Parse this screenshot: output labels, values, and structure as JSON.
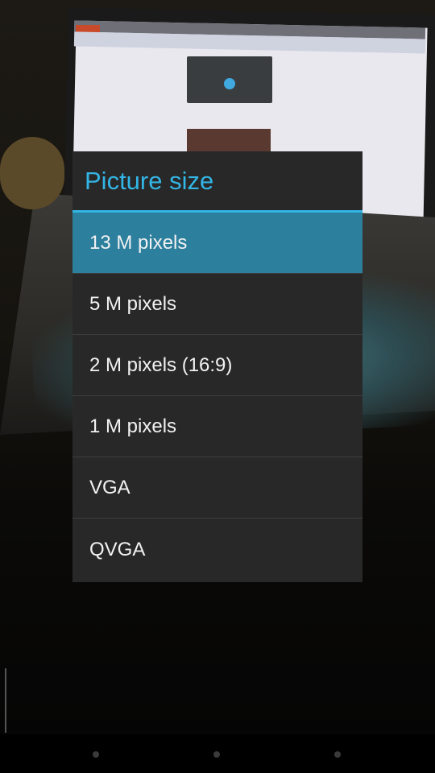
{
  "dialog": {
    "title": "Picture size",
    "selected_index": 0,
    "options": [
      {
        "label": "13 M pixels"
      },
      {
        "label": "5 M pixels"
      },
      {
        "label": "2 M pixels (16:9)"
      },
      {
        "label": "1 M pixels"
      },
      {
        "label": "VGA"
      },
      {
        "label": "QVGA"
      }
    ]
  },
  "colors": {
    "accent": "#33b5e5",
    "selected_background": "#2c7f9d",
    "dialog_background": "#282828",
    "option_text": "#f2f2f2"
  },
  "navbar": {
    "buttons": [
      "back-dot-icon",
      "home-dot-icon",
      "recents-dot-icon"
    ]
  }
}
